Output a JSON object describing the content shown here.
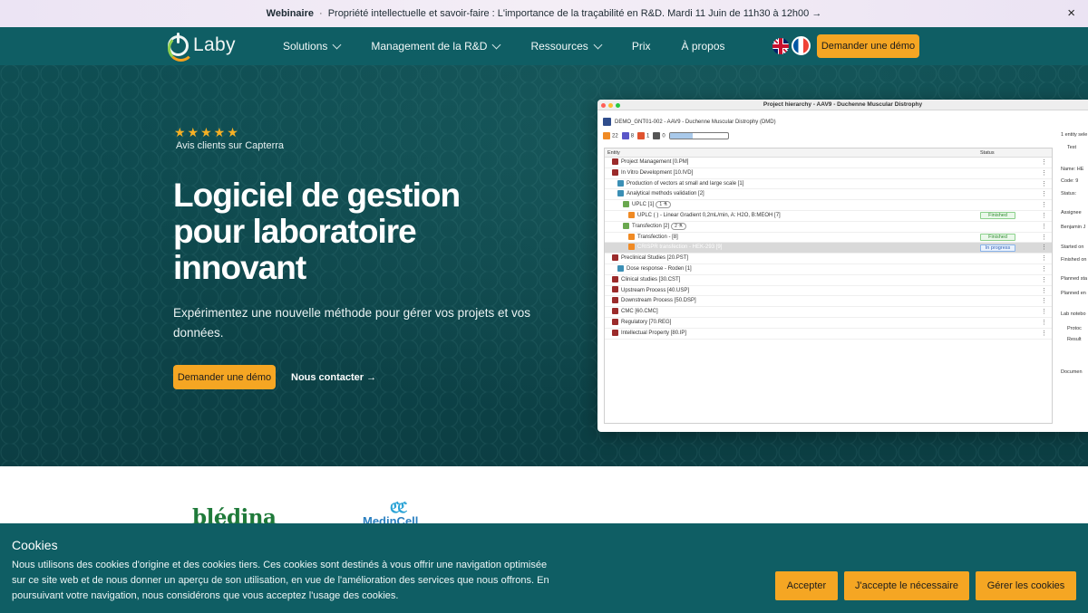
{
  "announcement": {
    "label": "Webinaire",
    "separator": "·",
    "text": "Propriété intellectuelle et savoir-faire : L'importance de la traçabilité en R&D. Mardi 11 Juin de 11h30 à 12h00 →",
    "close": "×"
  },
  "nav": {
    "logo": "Laby",
    "items": [
      {
        "label": "Solutions",
        "dropdown": true
      },
      {
        "label": "Management de la R&D",
        "dropdown": true
      },
      {
        "label": "Ressources",
        "dropdown": true
      },
      {
        "label": "Prix",
        "dropdown": false
      },
      {
        "label": "À propos",
        "dropdown": false
      }
    ],
    "cta": "Demander une démo"
  },
  "hero": {
    "stars": "★★★★★",
    "rating_label": "Avis clients sur Capterra",
    "title": "Logiciel de gestion pour laboratoire innovant",
    "subtitle": "Expérimentez une nouvelle méthode pour gérer vos projets et vos données.",
    "cta_primary": "Demander une démo",
    "cta_secondary": "Nous contacter →"
  },
  "app": {
    "window_title": "Project hierarchy - AAV9 - Duchenne Muscular Distrophy",
    "project_line": "DEMO_GNT01-002 - AAV9 - Duchenne Muscular Distrophy (DMD)",
    "counters": [
      {
        "value": "22",
        "color": "#f08a24"
      },
      {
        "value": "8",
        "color": "#5a56c8"
      },
      {
        "value": "1",
        "color": "#e0532f"
      },
      {
        "value": "0",
        "color": "#555555"
      }
    ],
    "progress_fraction": 0.4,
    "columns": {
      "entity": "Entity",
      "status": "Status"
    },
    "rows": [
      {
        "label": "Project Management [0.PM]",
        "indent": 0,
        "icon": "#9b2b2b",
        "status": ""
      },
      {
        "label": "In Vitro Development [10.IVD]",
        "indent": 0,
        "icon": "#9b2b2b",
        "status": ""
      },
      {
        "label": "Production of vectors at small and large scale [1]",
        "indent": 1,
        "icon": "#3b8fb5",
        "status": ""
      },
      {
        "label": "Analytical methods validation [2]",
        "indent": 1,
        "icon": "#3b8fb5",
        "status": ""
      },
      {
        "label": "UPLC [1]",
        "indent": 2,
        "icon": "#6aa84f",
        "status": "",
        "badge": "1 ⚗"
      },
      {
        "label": "UPLC ( ) - Linear Gradient 0,2mL/min, A: H2O, B:MEOH [7]",
        "indent": 3,
        "icon": "#f08a24",
        "status": "Finished"
      },
      {
        "label": "Transfection [2]",
        "indent": 2,
        "icon": "#6aa84f",
        "status": "",
        "badge": "2 ⚗"
      },
      {
        "label": "Transfection -  [8]",
        "indent": 3,
        "icon": "#f08a24",
        "status": "Finished"
      },
      {
        "label": "CRISPR transfection - HEK-293 [9]",
        "indent": 3,
        "icon": "#f08a24",
        "status": "In progress",
        "selected": true
      },
      {
        "label": "Preclinical Studies [20.PST]",
        "indent": 0,
        "icon": "#9b2b2b",
        "status": ""
      },
      {
        "label": "Dose response - Roden [1]",
        "indent": 1,
        "icon": "#3b8fb5",
        "status": ""
      },
      {
        "label": "Clinical studies [30.CST]",
        "indent": 0,
        "icon": "#9b2b2b",
        "status": ""
      },
      {
        "label": "Upstream Process [40.USP]",
        "indent": 0,
        "icon": "#9b2b2b",
        "status": ""
      },
      {
        "label": "Downstream Process [50.DSP]",
        "indent": 0,
        "icon": "#9b2b2b",
        "status": ""
      },
      {
        "label": "CMC [60.CMC]",
        "indent": 0,
        "icon": "#9b2b2b",
        "status": ""
      },
      {
        "label": "Regulatory [70.REG]",
        "indent": 0,
        "icon": "#9b2b2b",
        "status": ""
      },
      {
        "label": "Intellectual Property [80.IP]",
        "indent": 0,
        "icon": "#9b2b2b",
        "status": ""
      }
    ],
    "side": {
      "selection": "1 entity sele",
      "test": "Test",
      "name": "Name:  HE",
      "code": "Code:  9",
      "status": "Status:",
      "assignee": "Assignee",
      "assignee_name": "Benjamin J",
      "started": "Started on",
      "finished": "Finished on",
      "planned_start": "Planned sta",
      "planned_end": "Planned en",
      "notebook": "Lab notebo",
      "protocol": "Protoc",
      "result": "Result",
      "documents": "Documen"
    }
  },
  "logos": {
    "bledina": "blédina",
    "medincell": "MedinCell"
  },
  "cookies": {
    "title": "Cookies",
    "text": "Nous utilisons des cookies d'origine et des cookies tiers. Ces cookies sont destinés à vous offrir une navigation optimisée sur ce site web et de nous donner un aperçu de son utilisation, en vue de l'amélioration des services que nous offrons. En poursuivant votre navigation, nous considérons que vous acceptez l'usage des cookies.",
    "accept": "Accepter",
    "necessary": "J'accepte le nécessaire",
    "manage": "Gérer les cookies"
  }
}
